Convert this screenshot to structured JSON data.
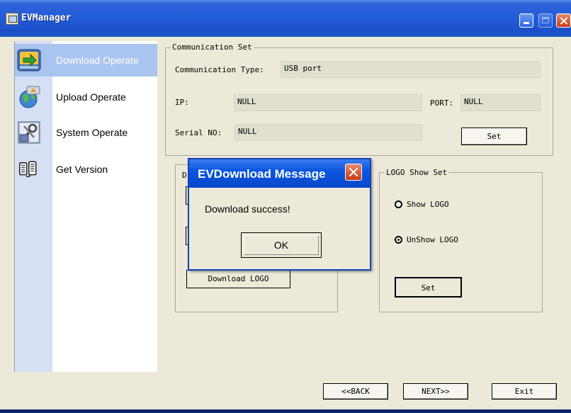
{
  "window": {
    "title": "EVManager"
  },
  "sidebar": {
    "items": [
      {
        "label": "Download Operate",
        "icon": "download-icon",
        "active": true
      },
      {
        "label": "Upload Operate",
        "icon": "globe-upload-icon",
        "active": false
      },
      {
        "label": "System Operate",
        "icon": "system-tools-icon",
        "active": false
      },
      {
        "label": "Get Version",
        "icon": "version-icon",
        "active": false
      }
    ]
  },
  "communication": {
    "group_label": "Communication Set",
    "type_label": "Communication Type:",
    "type_value": "USB port",
    "ip_label": "IP:",
    "ip_value": "NULL",
    "port_label": "PORT:",
    "port_value": "NULL",
    "serial_label": "Serial NO:",
    "serial_value": "NULL",
    "set_label": "Set"
  },
  "download": {
    "group_label": "D",
    "download_logo_label": "Download LOGO"
  },
  "logo_show": {
    "group_label": "LOGO Show Set",
    "show_label": "Show LOGO",
    "unshow_label": "UnShow LOGO",
    "selected": "UnShow LOGO",
    "set_label": "Set"
  },
  "footer": {
    "back_label": "<<BACK",
    "next_label": "NEXT>>",
    "exit_label": "Exit"
  },
  "dialog": {
    "title": "EVDownload Message",
    "message": "Download success!",
    "ok_label": "OK"
  },
  "colors": {
    "titlebar": "#245edb",
    "sidebar_active": "#a9c4ee",
    "window_bg": "#ece9d8"
  }
}
